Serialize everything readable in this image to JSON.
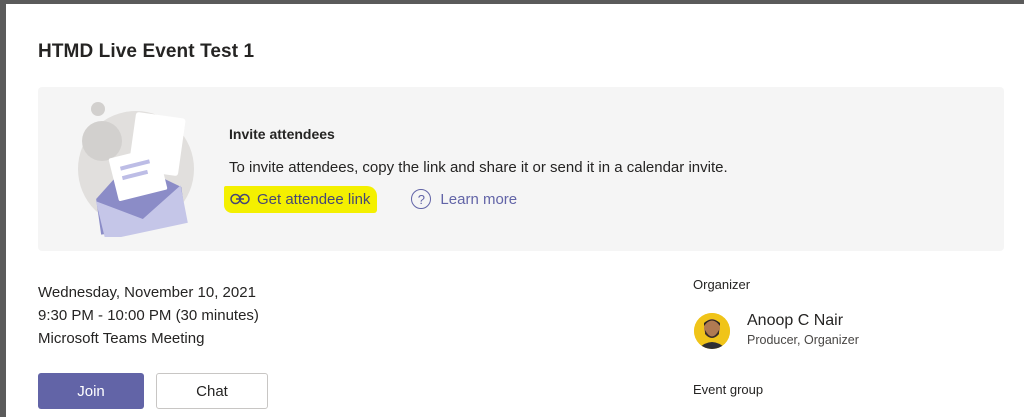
{
  "dialog": {
    "title": "HTMD Live Event Test 1"
  },
  "invite": {
    "title": "Invite attendees",
    "description": "To invite attendees, copy the link and share it or send it in a calendar invite.",
    "get_link_label": "Get attendee link",
    "learn_more_label": "Learn more",
    "link_icon": "link-icon",
    "help_icon": "question-circle-icon"
  },
  "event": {
    "date": "Wednesday, November 10, 2021",
    "time": "9:30 PM - 10:00 PM (30 minutes)",
    "type": "Microsoft Teams Meeting"
  },
  "actions": {
    "join_label": "Join",
    "chat_label": "Chat"
  },
  "organizer": {
    "section_label": "Organizer",
    "name": "Anoop C Nair",
    "role": "Producer, Organizer"
  },
  "event_group": {
    "section_label": "Event group"
  },
  "colors": {
    "accent": "#6264a7",
    "highlight": "#f4f000",
    "card_background": "#f5f5f5",
    "backdrop": "#5b5b5b"
  }
}
